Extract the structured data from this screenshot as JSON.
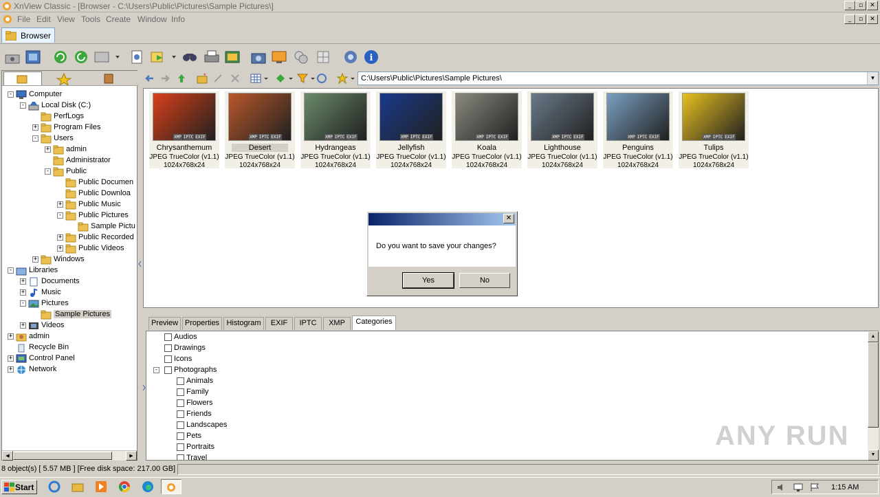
{
  "window": {
    "title": "XnView Classic - [Browser - C:\\Users\\Public\\Pictures\\Sample Pictures\\]",
    "min": "_",
    "max": "▫",
    "close": "✕"
  },
  "menu": [
    "File",
    "Edit",
    "View",
    "Tools",
    "Create",
    "Window",
    "Info"
  ],
  "tab": {
    "label": "Browser"
  },
  "nav": {
    "path": "C:\\Users\\Public\\Pictures\\Sample Pictures\\"
  },
  "tree": [
    {
      "label": "Computer",
      "icon": "computer-icon"
    },
    {
      "label": "Local Disk (C:)",
      "icon": "drive-icon"
    },
    {
      "label": "PerfLogs",
      "icon": "folder-icon"
    },
    {
      "label": "Program Files",
      "icon": "folder-icon"
    },
    {
      "label": "Users",
      "icon": "folder-icon"
    },
    {
      "label": "admin",
      "icon": "folder-icon"
    },
    {
      "label": "Administrator",
      "icon": "folder-icon"
    },
    {
      "label": "Public",
      "icon": "folder-icon"
    },
    {
      "label": "Public Documen",
      "icon": "folder-icon"
    },
    {
      "label": "Public Downloa",
      "icon": "folder-icon"
    },
    {
      "label": "Public Music",
      "icon": "folder-icon"
    },
    {
      "label": "Public Pictures",
      "icon": "folder-icon"
    },
    {
      "label": "Sample Pictu",
      "icon": "folder-icon"
    },
    {
      "label": "Public Recorded",
      "icon": "folder-icon"
    },
    {
      "label": "Public Videos",
      "icon": "folder-icon"
    },
    {
      "label": "Windows",
      "icon": "folder-icon"
    },
    {
      "label": "Libraries",
      "icon": "libraries-icon"
    },
    {
      "label": "Documents",
      "icon": "documents-icon"
    },
    {
      "label": "Music",
      "icon": "music-icon"
    },
    {
      "label": "Pictures",
      "icon": "pictures-icon"
    },
    {
      "label": "Sample Pictures",
      "icon": "folder-icon"
    },
    {
      "label": "Videos",
      "icon": "videos-icon"
    },
    {
      "label": "admin",
      "icon": "user-icon"
    },
    {
      "label": "Recycle Bin",
      "icon": "recycle-bin-icon"
    },
    {
      "label": "Control Panel",
      "icon": "control-panel-icon"
    },
    {
      "label": "Network",
      "icon": "network-icon"
    }
  ],
  "thumbnails": [
    {
      "name": "Chrysanthemum",
      "format": "JPEG TrueColor (v1.1)",
      "dims": "1024x768x24",
      "color": "#d8401a"
    },
    {
      "name": "Desert",
      "format": "JPEG TrueColor (v1.1)",
      "dims": "1024x768x24",
      "color": "#b8582a"
    },
    {
      "name": "Hydrangeas",
      "format": "JPEG TrueColor (v1.1)",
      "dims": "1024x768x24",
      "color": "#6a8a6a"
    },
    {
      "name": "Jellyfish",
      "format": "JPEG TrueColor (v1.1)",
      "dims": "1024x768x24",
      "color": "#1a3a8a"
    },
    {
      "name": "Koala",
      "format": "JPEG TrueColor (v1.1)",
      "dims": "1024x768x24",
      "color": "#8a8a80"
    },
    {
      "name": "Lighthouse",
      "format": "JPEG TrueColor (v1.1)",
      "dims": "1024x768x24",
      "color": "#6a7a8a"
    },
    {
      "name": "Penguins",
      "format": "JPEG TrueColor (v1.1)",
      "dims": "1024x768x24",
      "color": "#7aa0c0"
    },
    {
      "name": "Tulips",
      "format": "JPEG TrueColor (v1.1)",
      "dims": "1024x768x24",
      "color": "#e8c020"
    }
  ],
  "badges": [
    "XMP",
    "IPTC",
    "EXIF"
  ],
  "dialog": {
    "message": "Do you want to save your changes?",
    "yes": "Yes",
    "no": "No",
    "close": "✕"
  },
  "bottom_tabs": [
    "Preview",
    "Properties",
    "Histogram",
    "EXIF",
    "IPTC",
    "XMP",
    "Categories"
  ],
  "categories": [
    {
      "label": "Audios"
    },
    {
      "label": "Drawings"
    },
    {
      "label": "Icons"
    },
    {
      "label": "Photographs"
    },
    {
      "label": "Animals"
    },
    {
      "label": "Family"
    },
    {
      "label": "Flowers"
    },
    {
      "label": "Friends"
    },
    {
      "label": "Landscapes"
    },
    {
      "label": "Pets"
    },
    {
      "label": "Portraits"
    },
    {
      "label": "Travel"
    }
  ],
  "status": {
    "text": "8 object(s) [ 5.57 MB ] [Free disk space: 217.00 GB]"
  },
  "taskbar": {
    "start": "Start",
    "time": "1:15 AM"
  },
  "watermark": "ANY RUN"
}
